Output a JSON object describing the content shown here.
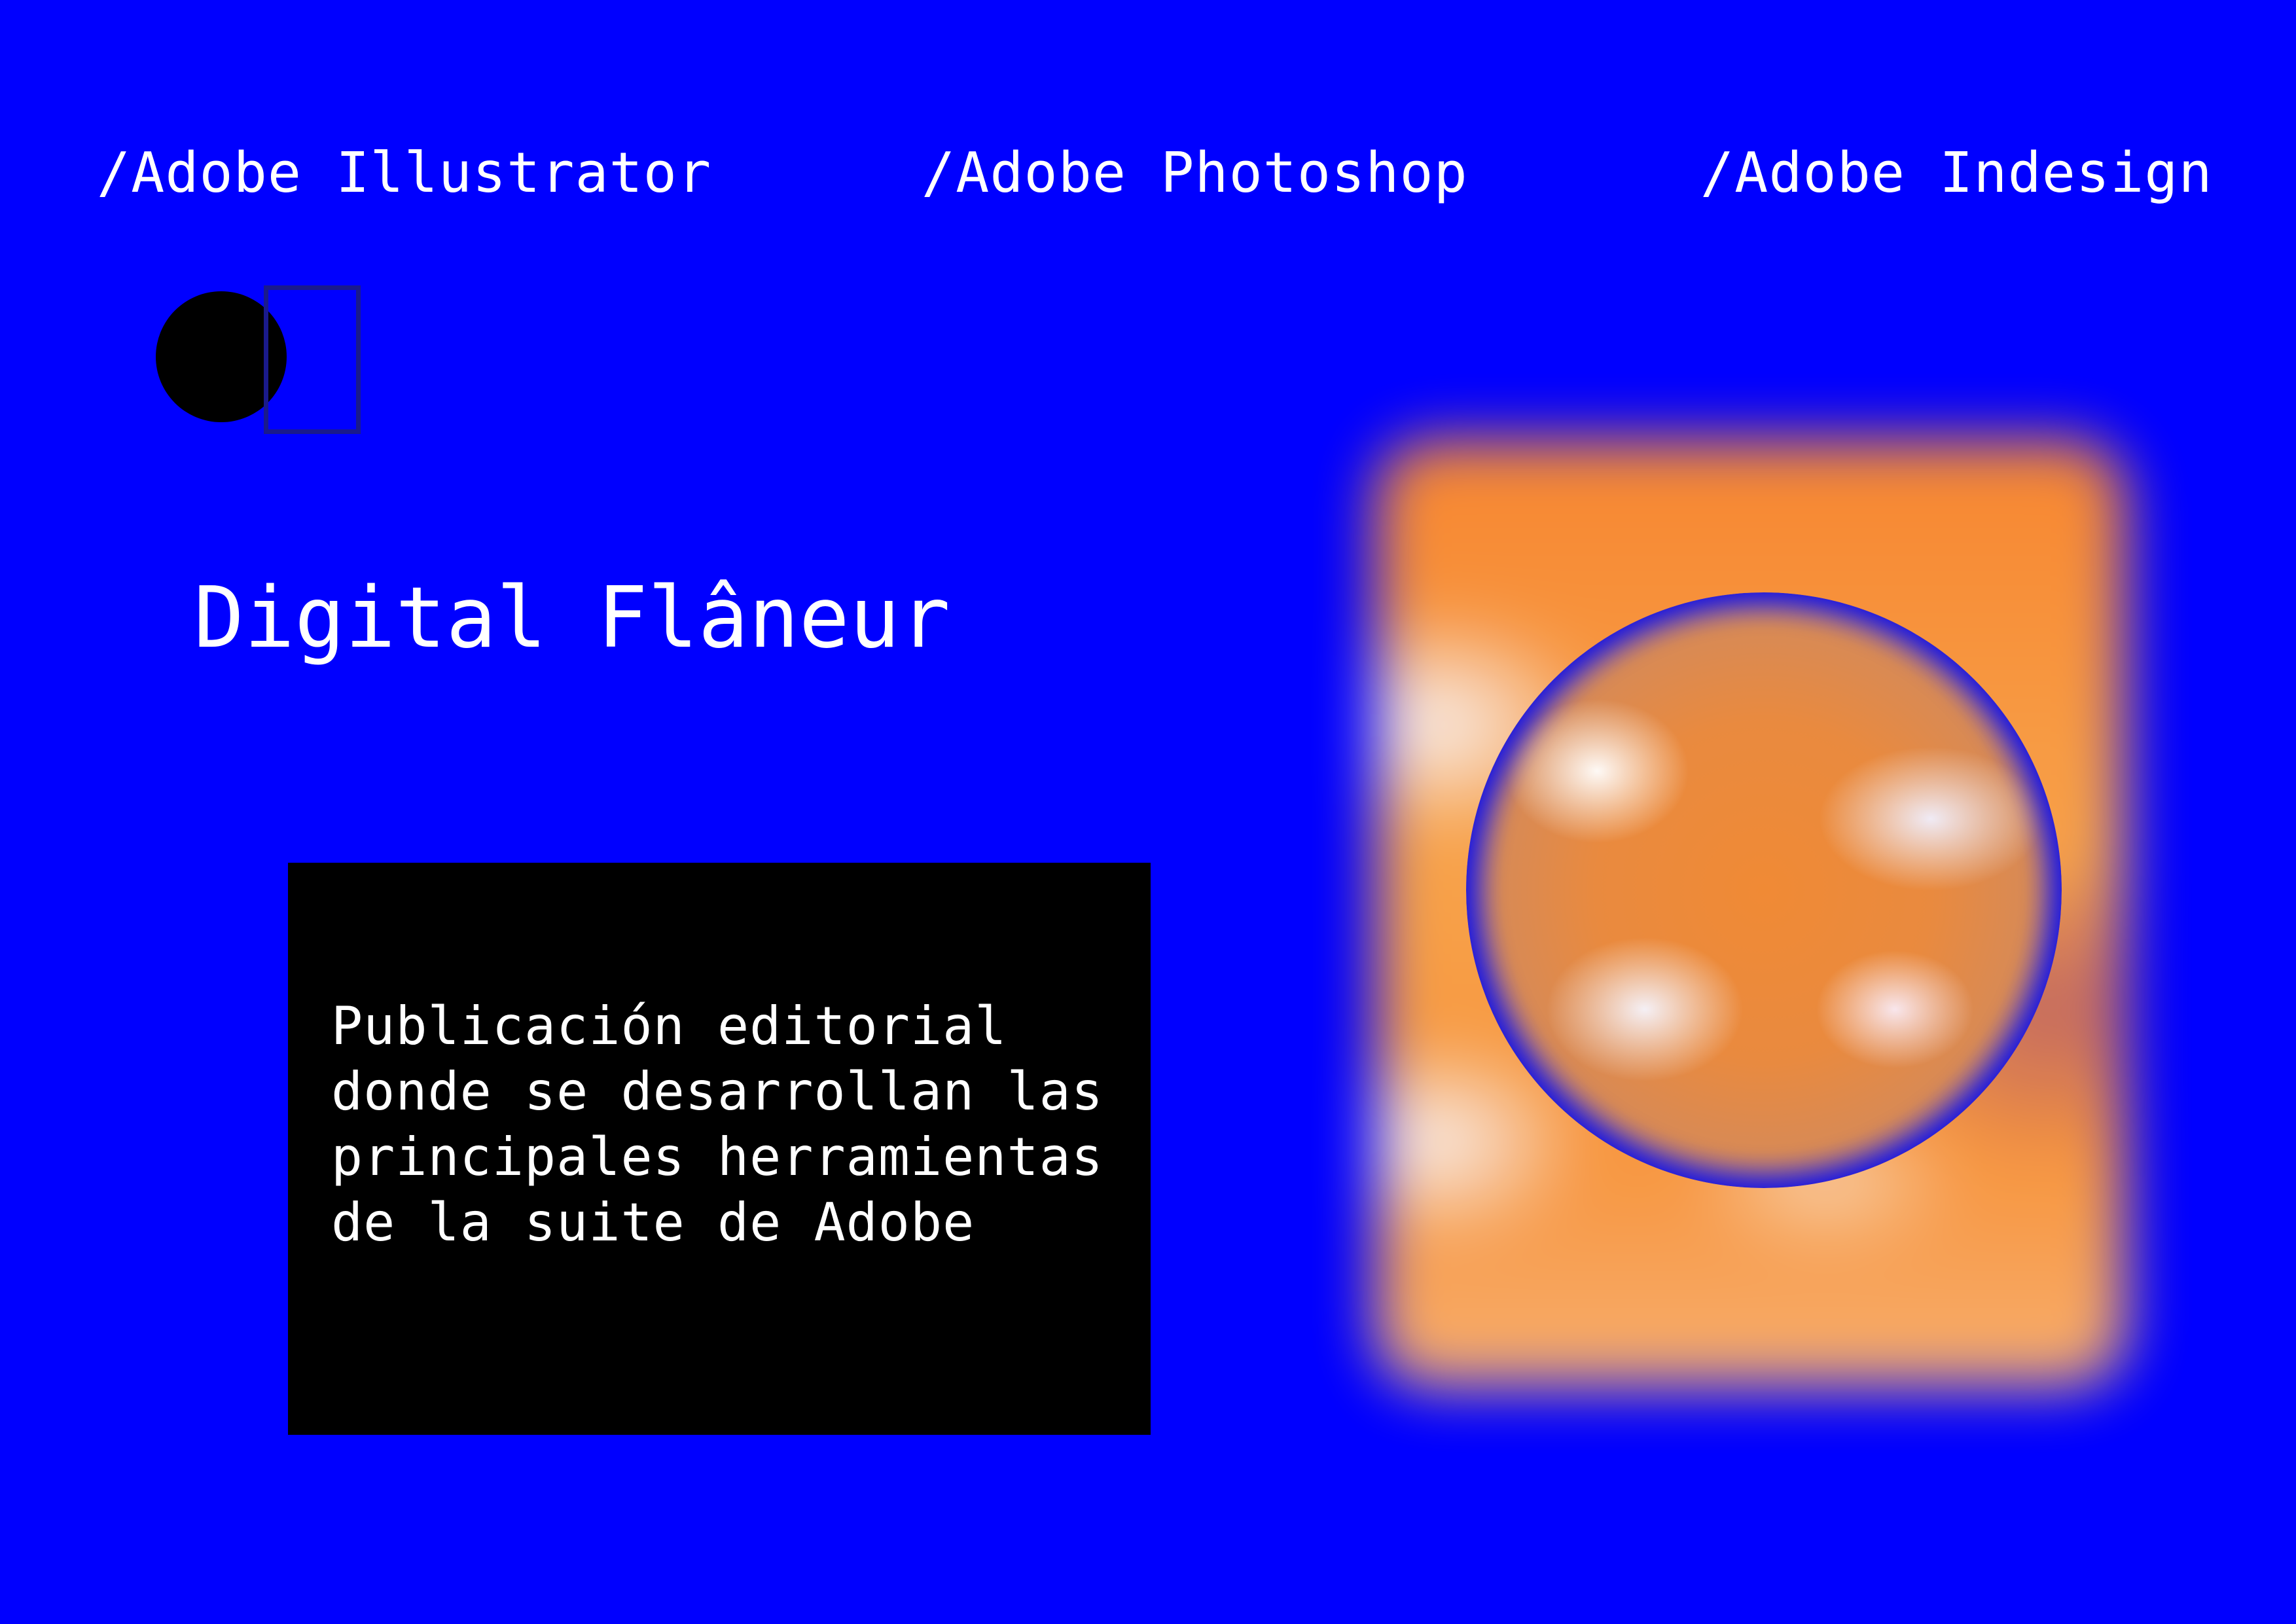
{
  "nav": {
    "items": [
      {
        "label": "/Adobe Illustrator"
      },
      {
        "label": "/Adobe Photoshop"
      },
      {
        "label": "/Adobe Indesign"
      }
    ]
  },
  "title": "Digital Flâneur",
  "description": "Publicación editorial\ndonde se desarrollan las\nprincipales herramientas\nde la suite de Adobe",
  "colors": {
    "background": "#0000ff",
    "box": "#000000",
    "text": "#ffffff",
    "accent_orange": "#ff9a38"
  }
}
